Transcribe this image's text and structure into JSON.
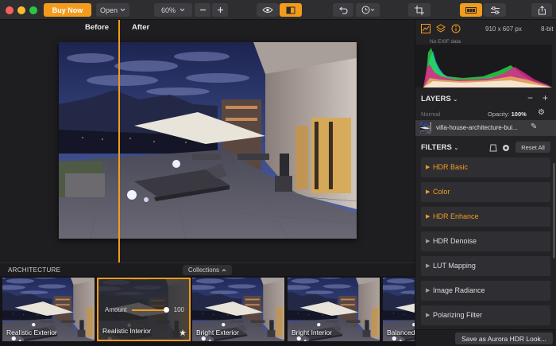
{
  "toolbar": {
    "buy_label": "Buy Now",
    "open_label": "Open",
    "zoom_value": "60%",
    "icons": [
      "minus-icon",
      "plus-icon",
      "eye-icon",
      "compare-icon",
      "undo-icon",
      "history-icon",
      "crop-icon",
      "presets-panel-icon",
      "adjustments-icon",
      "share-icon"
    ]
  },
  "canvas": {
    "before_label": "Before",
    "after_label": "After"
  },
  "presets": {
    "category": "ARCHITECTURE",
    "collections_label": "Collections",
    "items": [
      {
        "label": "Realistic Exterior"
      },
      {
        "label": "Realistic Interior",
        "amount_label": "Amount",
        "amount_value": "100"
      },
      {
        "label": "Bright Exterior"
      },
      {
        "label": "Bright Interior"
      },
      {
        "label": "Balanced I"
      }
    ]
  },
  "panel": {
    "dimensions": "910 x 607 px",
    "bit_depth": "8-bit",
    "exif": "No EXIF data",
    "layers_title": "LAYERS",
    "blend_mode": "Normal",
    "opacity_label": "Opacity:",
    "opacity_value": "100%",
    "layer_name": "villa-house-architecture-bui...",
    "filters_title": "FILTERS",
    "reset_label": "Reset All",
    "filters": [
      {
        "name": "HDR Basic",
        "highlight": true
      },
      {
        "name": "Color",
        "highlight": true
      },
      {
        "name": "HDR Enhance",
        "highlight": true
      },
      {
        "name": "HDR Denoise",
        "highlight": false
      },
      {
        "name": "LUT Mapping",
        "highlight": false
      },
      {
        "name": "Image Radiance",
        "highlight": false
      },
      {
        "name": "Polarizing Filter",
        "highlight": false
      }
    ],
    "save_label": "Save as Aurora HDR Look..."
  },
  "colors": {
    "accent": "#f39c1c",
    "panel_bg": "#232326",
    "toolbar_bg": "#2e2e31"
  }
}
